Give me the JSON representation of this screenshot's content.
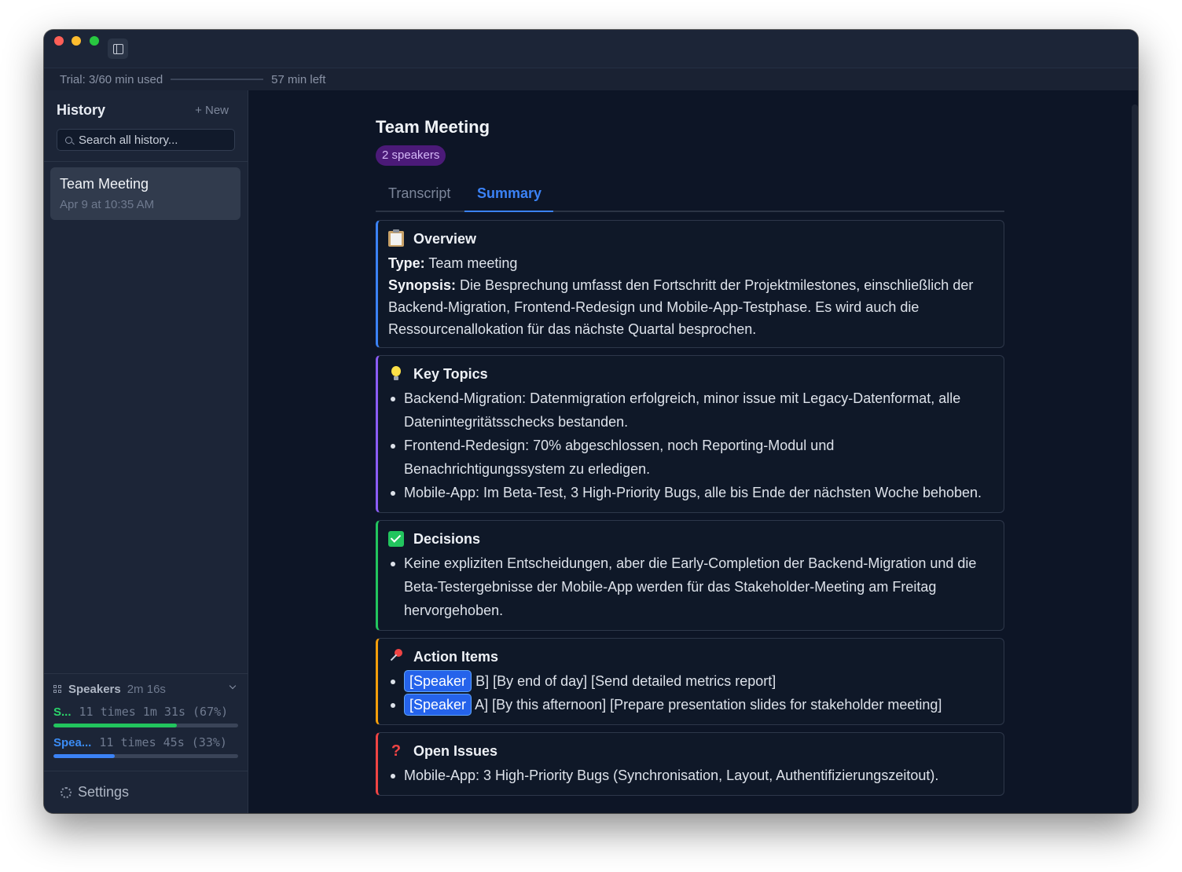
{
  "trial": {
    "used": "Trial: 3/60 min used",
    "left": "57 min left",
    "progress": 0.05
  },
  "sidebar": {
    "title": "History",
    "new_label": "+ New",
    "search_placeholder": "Search all history...",
    "items": [
      {
        "title": "Team Meeting",
        "date": "Apr 9 at 10:35 AM"
      }
    ],
    "speakers": {
      "label": "Speakers",
      "duration": "2m 16s",
      "rows": [
        {
          "name": "S...",
          "stats": "11 times 1m 31s (67%)",
          "share": 0.67,
          "color": "#22c55e"
        },
        {
          "name": "Spea...",
          "stats": "11 times 45s (33%)",
          "share": 0.33,
          "color": "#3b82f6"
        }
      ]
    },
    "settings_label": "Settings"
  },
  "main": {
    "title": "Team Meeting",
    "badge": "2 speakers",
    "tabs": [
      {
        "label": "Transcript"
      },
      {
        "label": "Summary",
        "active": true
      }
    ],
    "sections": {
      "overview": {
        "title": "Overview",
        "type_label": "Type:",
        "type_value": "Team meeting",
        "synopsis_label": "Synopsis:",
        "synopsis_value": "Die Besprechung umfasst den Fortschritt der Projektmilestones, einschließlich der Backend-Migration, Frontend-Redesign und Mobile-App-Testphase. Es wird auch die Ressourcenallokation für das nächste Quartal besprochen.",
        "accent": "#3b82f6"
      },
      "key_topics": {
        "title": "Key Topics",
        "items": [
          "Backend-Migration: Datenmigration erfolgreich, minor issue mit Legacy-Datenformat, alle Datenintegritätsschecks bestanden.",
          "Frontend-Redesign: 70% abgeschlossen, noch Reporting-Modul und Benachrichtigungssystem zu erledigen.",
          "Mobile-App: Im Beta-Test, 3 High-Priority Bugs, alle bis Ende der nächsten Woche behoben."
        ],
        "accent": "#8b5cf6"
      },
      "decisions": {
        "title": "Decisions",
        "items": [
          "Keine expliziten Entscheidungen, aber die Early-Completion der Backend-Migration und die Beta-Testergebnisse der Mobile-App werden für das Stakeholder-Meeting am Freitag hervorgehoben."
        ],
        "accent": "#22c55e"
      },
      "action_items": {
        "title": "Action Items",
        "items": [
          {
            "tag": "[Speaker",
            "text": "B] [By end of day] [Send detailed metrics report]"
          },
          {
            "tag": "[Speaker",
            "text": "A] [By this afternoon] [Prepare presentation slides for stakeholder meeting]"
          }
        ],
        "accent": "#f59e0b"
      },
      "open_issues": {
        "title": "Open Issues",
        "items": [
          "Mobile-App: 3 High-Priority Bugs (Synchronisation, Layout, Authentifizierungszeitout)."
        ],
        "accent": "#ef4444"
      }
    }
  },
  "icons": {
    "overview": "clipboard-icon",
    "key_topics": "lightbulb-icon",
    "decisions": "check-mark-icon",
    "action_items": "pushpin-icon",
    "open_issues": "question-mark-icon"
  }
}
